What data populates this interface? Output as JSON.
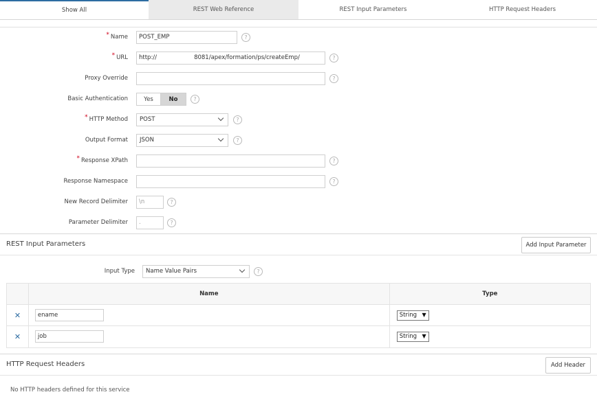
{
  "tabs": [
    {
      "label": "Show All"
    },
    {
      "label": "REST Web Reference"
    },
    {
      "label": "REST Input Parameters"
    },
    {
      "label": "HTTP Request Headers"
    }
  ],
  "form": {
    "name": {
      "label": "Name",
      "value": "POST_EMP",
      "required": true
    },
    "url": {
      "label": "URL",
      "value": "http://                    8081/apex/formation/ps/createEmp/",
      "required": true
    },
    "proxy": {
      "label": "Proxy Override",
      "value": ""
    },
    "basic_auth": {
      "label": "Basic Authentication",
      "yes": "Yes",
      "no": "No",
      "selected": "No"
    },
    "http_method": {
      "label": "HTTP Method",
      "value": "POST",
      "required": true
    },
    "output_format": {
      "label": "Output Format",
      "value": "JSON"
    },
    "response_xpath": {
      "label": "Response XPath",
      "value": "",
      "required": true
    },
    "response_namespace": {
      "label": "Response Namespace",
      "value": ""
    },
    "record_delimiter": {
      "label": "New Record Delimiter",
      "placeholder": "\\n"
    },
    "parameter_delimiter": {
      "label": "Parameter Delimiter",
      "placeholder": "."
    },
    "help_glyph": "?",
    "required_marker": "*"
  },
  "rest_input": {
    "title": "REST Input Parameters",
    "add_button": "Add Input Parameter",
    "input_type_label": "Input Type",
    "input_type_value": "Name Value Pairs",
    "columns": {
      "name": "Name",
      "type": "Type"
    },
    "rows": [
      {
        "name": "ename",
        "type": "String"
      },
      {
        "name": "job",
        "type": "String"
      }
    ],
    "remove_glyph": "✕",
    "dropdown_glyph": "▼"
  },
  "headers": {
    "title": "HTTP Request Headers",
    "add_button": "Add Header",
    "empty_message": "No HTTP headers defined for this service"
  },
  "colors": {
    "accent": "#2d6ca2",
    "required": "#d0021b",
    "toggle_selected": "#d6d6d6"
  }
}
